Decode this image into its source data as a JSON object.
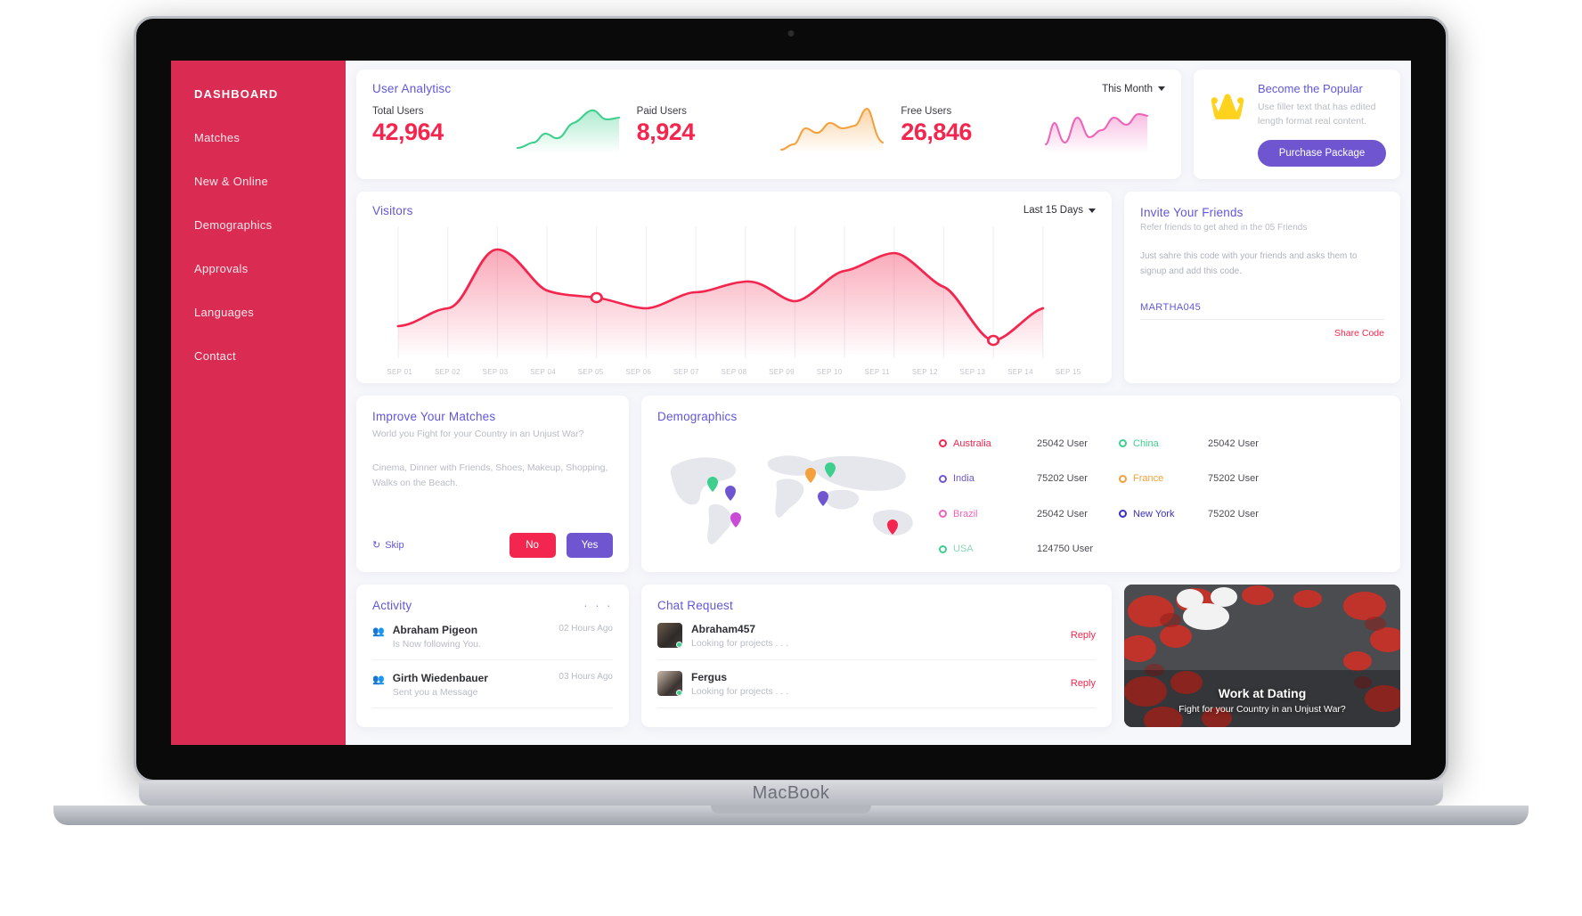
{
  "device": {
    "label": "MacBook"
  },
  "sidebar": {
    "brand": "DASHBOARD",
    "items": [
      {
        "label": "Matches"
      },
      {
        "label": "New & Online"
      },
      {
        "label": "Demographics"
      },
      {
        "label": "Approvals"
      },
      {
        "label": "Languages"
      },
      {
        "label": "Contact"
      }
    ]
  },
  "analytics": {
    "title": "User Analytisc",
    "period": "This Month",
    "metrics": [
      {
        "label": "Total Users",
        "value": "42,964",
        "color": "#3ecf8e"
      },
      {
        "label": "Paid Users",
        "value": "8,924",
        "color": "#f4a03c"
      },
      {
        "label": "Free Users",
        "value": "26,846",
        "color": "#ef63b8"
      }
    ]
  },
  "promo": {
    "icon": "crown-icon",
    "title": "Become the Popular",
    "text": "Use filler text that has edited length format real content.",
    "button": "Purchase Package",
    "button_color": "#6f56d0"
  },
  "visitors": {
    "title": "Visitors",
    "period": "Last 15 Days"
  },
  "invite": {
    "title": "Invite Your Friends",
    "subtitle": "Refer friends to get ahed in the 05 Friends",
    "body": "Just sahre this code with your friends and asks them to signup and add this code.",
    "code": "MARTHA045",
    "share": "Share Code"
  },
  "improve": {
    "title": "Improve Your Matches",
    "subtitle": "World you Fight for your Country in an Unjust War?",
    "list": "Cinema, Dinner with Friends, Shoes, Makeup, Shopping, Walks on the Beach.",
    "skip": "Skip",
    "no": "No",
    "yes": "Yes"
  },
  "demographics": {
    "title": "Demographics",
    "entries": [
      {
        "name": "Australia",
        "value": "25042 User",
        "color": "#f2264e"
      },
      {
        "name": "China",
        "value": "25042 User",
        "color": "#3ecf8e"
      },
      {
        "name": "India",
        "value": "75202 User",
        "color": "#6f56d0"
      },
      {
        "name": "France",
        "value": "75202 User",
        "color": "#f4a03c"
      },
      {
        "name": "Brazil",
        "value": "25042 User",
        "color": "#ef63b8"
      },
      {
        "name": "New York",
        "value": "75202 User",
        "color": "#3b30c4"
      },
      {
        "name": "USA",
        "value": "124750 User",
        "color": "#3ecf8e"
      }
    ]
  },
  "activity": {
    "title": "Activity",
    "menu": "· · ·",
    "items": [
      {
        "name": "Abraham Pigeon",
        "sub": "Is Now following You.",
        "time": "02 Hours Ago"
      },
      {
        "name": "Girth Wiedenbauer",
        "sub": "Sent you a Message",
        "time": "03 Hours Ago"
      }
    ]
  },
  "chat": {
    "title": "Chat Request",
    "items": [
      {
        "name": "Abraham457",
        "sub": "Looking for projects . . .",
        "action": "Reply"
      },
      {
        "name": "Fergus",
        "sub": "Looking for projects . . .",
        "action": "Reply"
      }
    ]
  },
  "banner": {
    "title": "Work at Dating",
    "subtitle": "Fight for your Country in an Unjust War?"
  },
  "chart_data": [
    {
      "type": "area",
      "title": "Total Users",
      "series": [
        {
          "name": "Total Users",
          "values": [
            8,
            14,
            10,
            30,
            24,
            28,
            44,
            62,
            58,
            72,
            88,
            84
          ]
        }
      ],
      "color": "#3ecf8e"
    },
    {
      "type": "area",
      "title": "Paid Users",
      "series": [
        {
          "name": "Paid Users",
          "values": [
            6,
            10,
            30,
            22,
            36,
            40,
            34,
            52,
            46,
            50,
            84,
            30
          ]
        }
      ],
      "color": "#f4a03c"
    },
    {
      "type": "area",
      "title": "Free Users",
      "series": [
        {
          "name": "Free Users",
          "values": [
            14,
            46,
            20,
            56,
            30,
            40,
            34,
            58,
            50,
            66,
            72,
            70
          ]
        }
      ],
      "color": "#ef63b8"
    },
    {
      "type": "area",
      "title": "Visitors",
      "xlabel": "",
      "ylabel": "",
      "grid": true,
      "legend": "none",
      "color": "#f2264e",
      "categories": [
        "SEP 01",
        "SEP 02",
        "SEP 03",
        "SEP 04",
        "SEP 05",
        "SEP 06",
        "SEP 07",
        "SEP 08",
        "SEP 09",
        "SEP 10",
        "SEP 11",
        "SEP 12",
        "SEP 13",
        "SEP 14",
        "SEP 15"
      ],
      "values": [
        20,
        34,
        74,
        52,
        44,
        41,
        32,
        40,
        52,
        46,
        64,
        78,
        58,
        12,
        36
      ],
      "markers": [
        {
          "x": "SEP 05",
          "y": 44
        },
        {
          "x": "SEP 14",
          "y": 12
        }
      ],
      "ylim": [
        0,
        100
      ]
    }
  ]
}
